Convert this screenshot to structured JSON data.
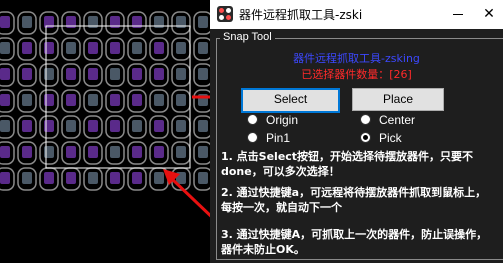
{
  "window": {
    "title": "器件远程抓取工具-zski",
    "close_glyph": "✕"
  },
  "group": {
    "label": "Snap Tool"
  },
  "tool_title": "器件远程抓取工具-zsking",
  "selected_count": "已选择器件数量：[26]",
  "buttons": {
    "select": "Select",
    "place": "Place"
  },
  "radios": [
    {
      "label": "Origin",
      "checked": false
    },
    {
      "label": "Center",
      "checked": false
    },
    {
      "label": "Pin1",
      "checked": false
    },
    {
      "label": "Pick",
      "checked": true
    }
  ],
  "instructions": [
    "1. 点击Select按钮，开始选择待摆放器件，只要不done，可以多次选择！",
    "2. 通过快捷键a，可远程将待摆放器件抓取到鼠标上，每按一次，就自动下一个",
    "3. 通过快捷键A，可抓取上一次的器件，防止误操作，器件未防止OK。"
  ],
  "colors": {
    "accent_blue": "#3c48ff",
    "alert_red": "#ff2a2a",
    "arrow_red": "#e81010",
    "pad_purple": "#5a2a8a",
    "pad_gray": "#4a5866",
    "outline_gray": "#8a8a8a"
  },
  "icons": {
    "app": "app-icon",
    "minimize": "minimize-icon",
    "close": "close-icon"
  }
}
